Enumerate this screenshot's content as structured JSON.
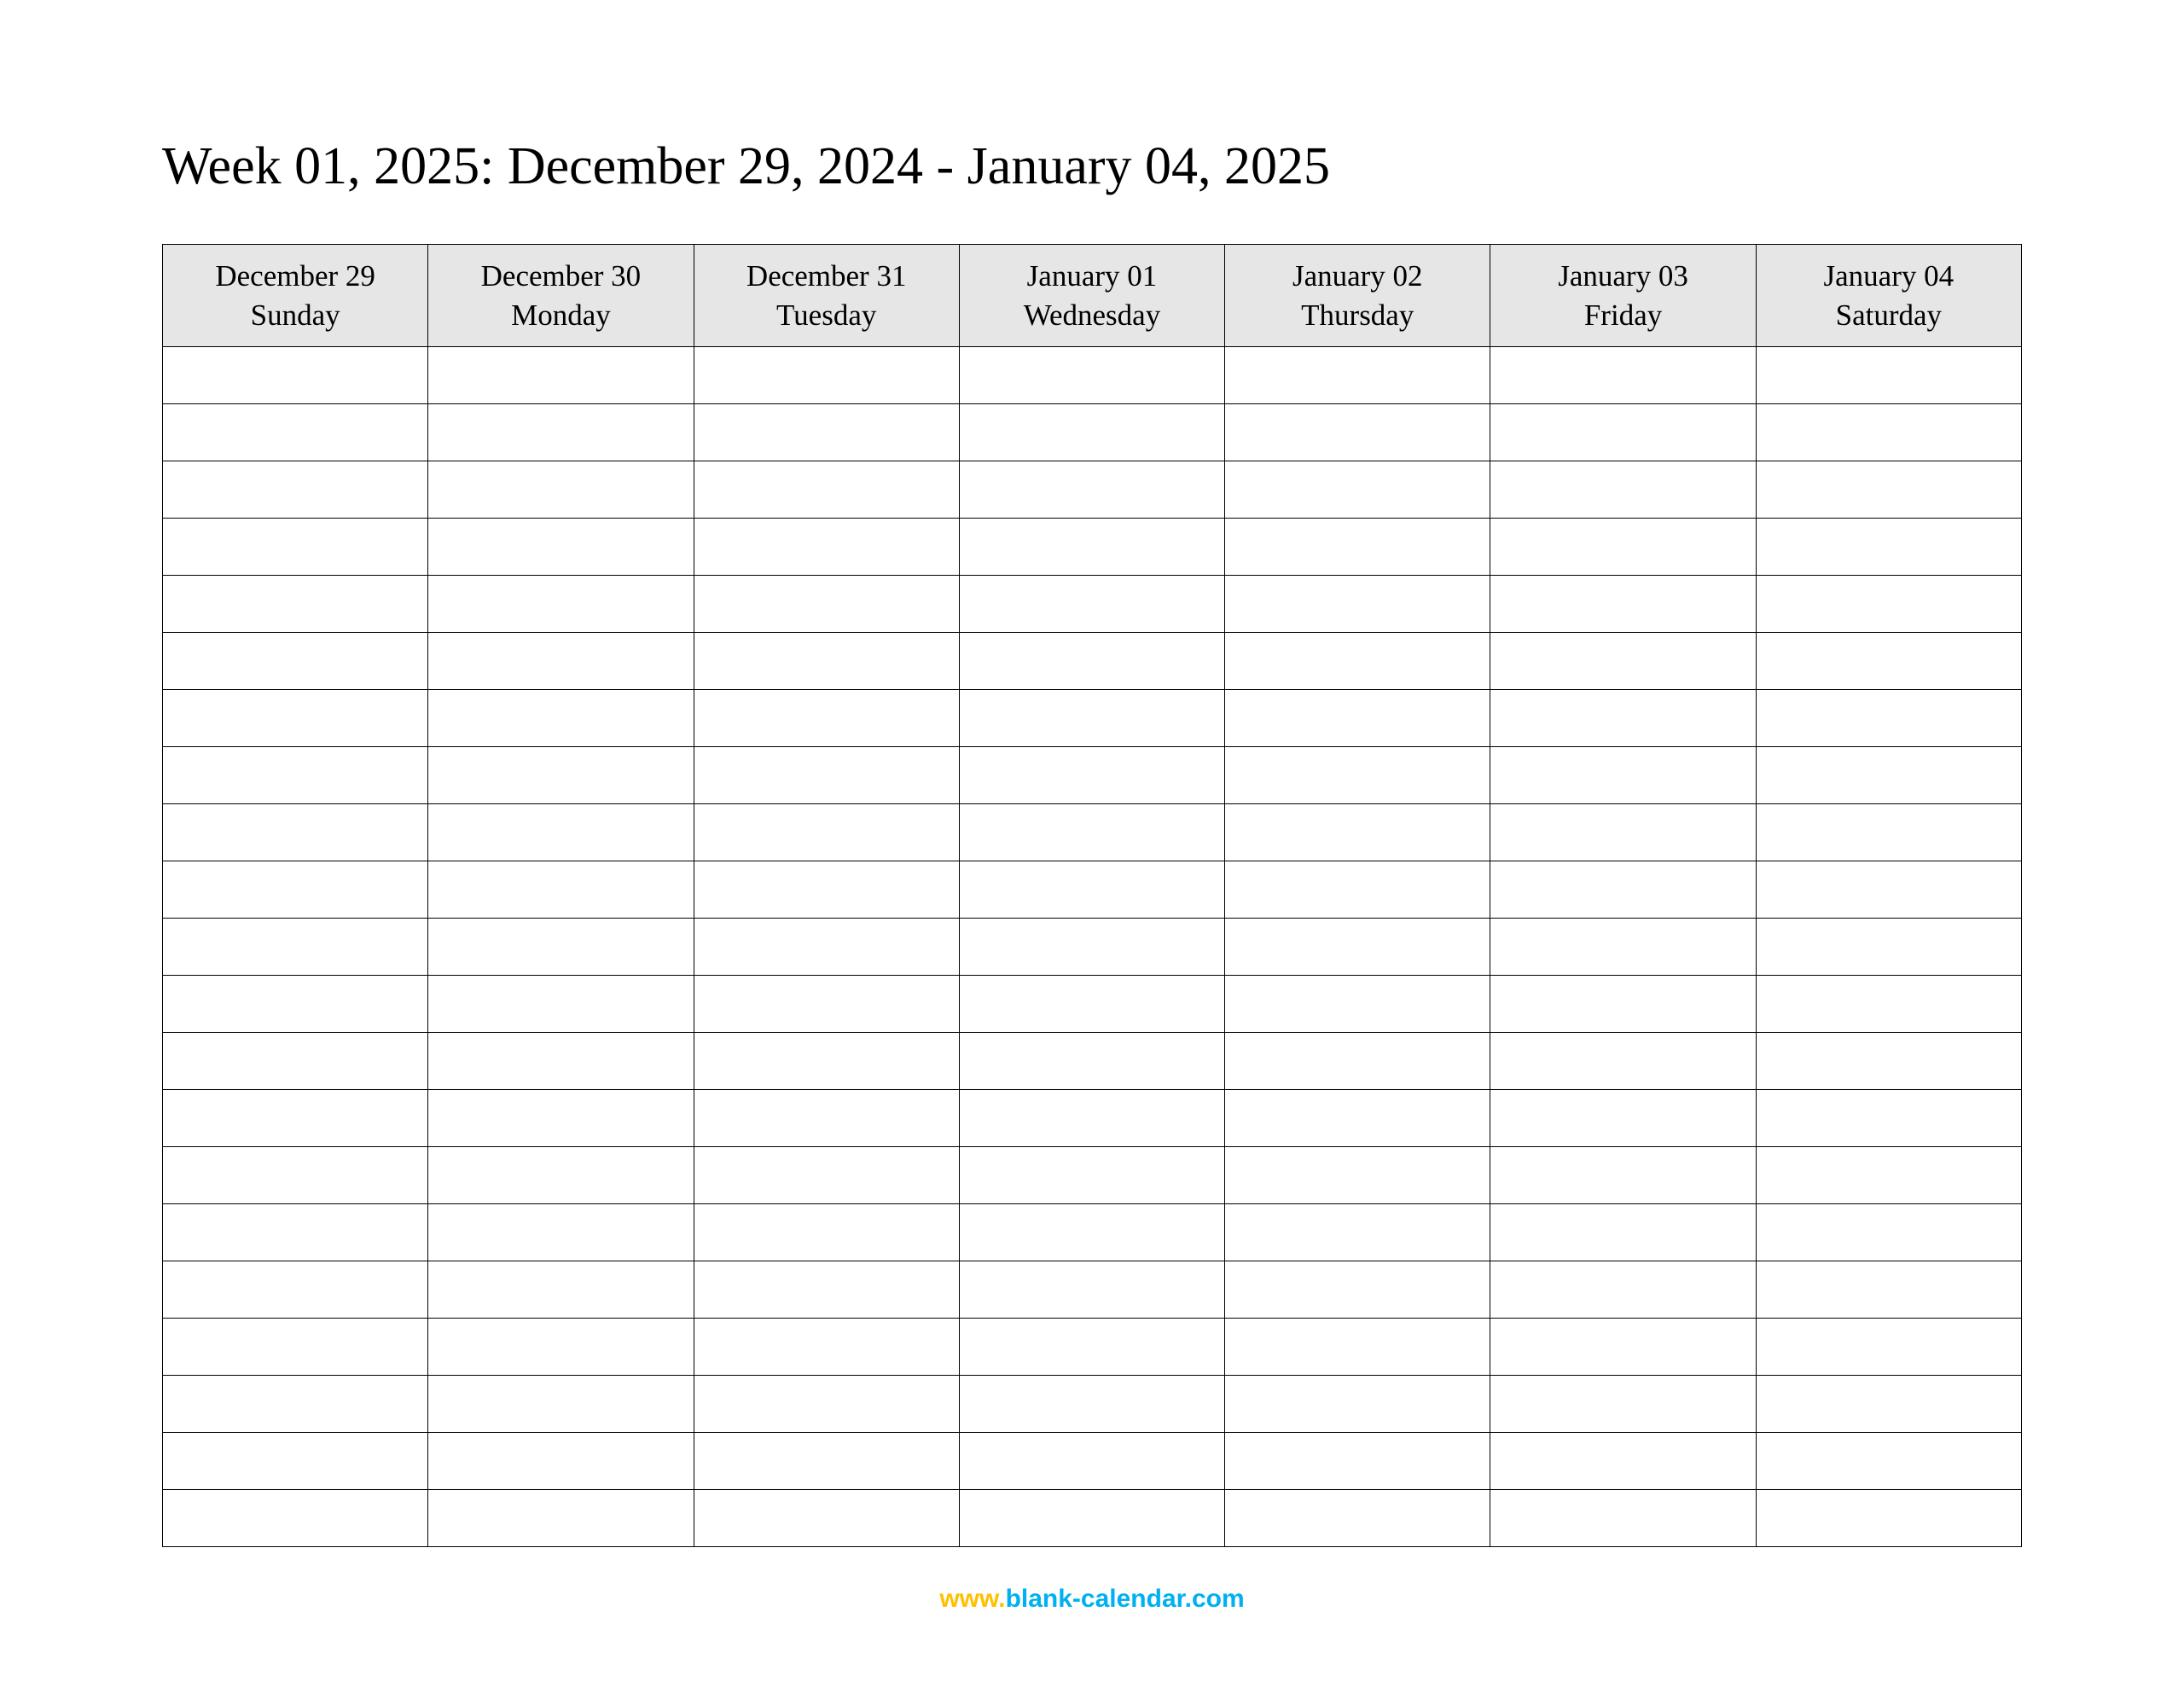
{
  "title": "Week 01, 2025: December 29, 2024 - January 04, 2025",
  "columns": [
    {
      "date": "December 29",
      "day": "Sunday"
    },
    {
      "date": "December 30",
      "day": "Monday"
    },
    {
      "date": "December 31",
      "day": "Tuesday"
    },
    {
      "date": "January 01",
      "day": "Wednesday"
    },
    {
      "date": "January 02",
      "day": "Thursday"
    },
    {
      "date": "January 03",
      "day": "Friday"
    },
    {
      "date": "January 04",
      "day": "Saturday"
    }
  ],
  "rows_count": 21,
  "footer": {
    "www": "www.",
    "domain": "blank-calendar.com"
  }
}
